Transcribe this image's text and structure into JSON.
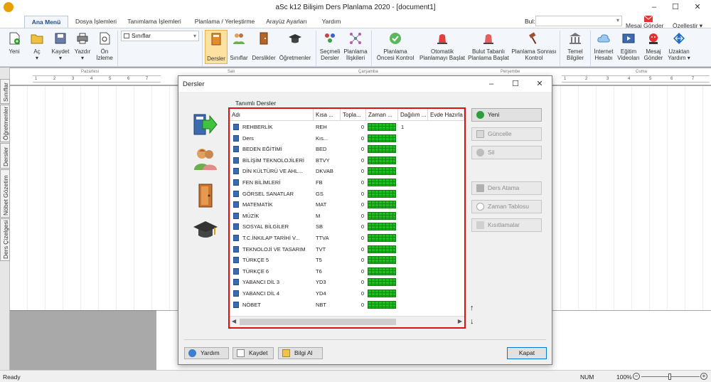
{
  "window": {
    "title": "aSc k12 Bilişim Ders Planlama 2020  - [document1]",
    "minimize": "–",
    "maximize": "☐",
    "close": "✕"
  },
  "ribbon_tabs": [
    "Ana Menü",
    "Dosya İşlemleri",
    "Tanımlama İşlemleri",
    "Planlama / Yerleştirme",
    "Arayüz Ayarları",
    "Yardım"
  ],
  "topright": {
    "search_label": "Bul:",
    "search_value": "",
    "mesaj": "Mesaj Gönder",
    "ozellestir": "Özelleştir ▾"
  },
  "ribbon": {
    "yeni": "Yeni",
    "ac": "Aç",
    "kaydet": "Kaydet",
    "yazdir": "Yazdır",
    "on_izleme_1": "Ön",
    "on_izleme_2": "İzleme",
    "class_selector": "Sınıflar",
    "dersler": "Dersler",
    "siniflar": "Sınıflar",
    "derslikler": "Derslikler",
    "ogretmenler": "Öğretmenler",
    "secmeli_1": "Seçmeli",
    "secmeli_2": "Dersler",
    "iliskileri_1": "Planlama",
    "iliskileri_2": "İlişkileri",
    "onces_1": "Planlama",
    "onces_2": "Öncesi Kontrol",
    "otomatik_1": "Otomatik",
    "otomatik_2": "Planlamayı Başlat",
    "bulut_1": "Bulut Tabanlı",
    "bulut_2": "Planlama Başlat",
    "sonrasi_1": "Planlama Sonrası",
    "sonrasi_2": "Kontrol",
    "temel_1": "Temel",
    "temel_2": "Bilgiler",
    "internet_1": "İnternet",
    "internet_2": "Hesabı",
    "egitim_1": "Eğitim",
    "egitim_2": "Videoları",
    "mesaj_1": "Mesaj",
    "mesaj_2": "Gönder",
    "uzaktan_1": "Uzaktan",
    "uzaktan_2": "Yardım ▾"
  },
  "left_tabs": [
    "Sınıflar",
    "Öğretmenler",
    "Dersler",
    "Nöbet Gözetim",
    "Ders Çizelgesi"
  ],
  "days": [
    "Pazartesi",
    "Salı",
    "Çarşamba",
    "Perşembe",
    "Cuma"
  ],
  "period_numbers": [
    "1",
    "2",
    "3",
    "4",
    "5",
    "6",
    "7"
  ],
  "status": {
    "ready": "Ready",
    "num": "NUM",
    "zoom": "100%"
  },
  "dialog": {
    "title": "Dersler",
    "section_label": "Tanımlı Dersler",
    "columns": [
      "Adı",
      "Kısa ...",
      "Topla...",
      "Zaman ...",
      "Dağılım ...",
      "Evde Hazırla"
    ],
    "rows": [
      {
        "name": "REHBERLİK",
        "short": "REH",
        "total": "0",
        "dist": "1"
      },
      {
        "name": "Ders",
        "short": "Kıs...",
        "total": "0",
        "dist": ""
      },
      {
        "name": "BEDEN EĞİTİMİ",
        "short": "BED",
        "total": "0",
        "dist": ""
      },
      {
        "name": "BİLİŞİM TEKNOLOJİLERİ",
        "short": "BTVY",
        "total": "0",
        "dist": ""
      },
      {
        "name": "DİN KÜLTÜRÜ VE AHL...",
        "short": "DKVAB",
        "total": "0",
        "dist": ""
      },
      {
        "name": "FEN BİLİMLERİ",
        "short": "FB",
        "total": "0",
        "dist": ""
      },
      {
        "name": "GÖRSEL SANATLAR",
        "short": "GS",
        "total": "0",
        "dist": ""
      },
      {
        "name": "MATEMATİK",
        "short": "MAT",
        "total": "0",
        "dist": ""
      },
      {
        "name": "MÜZİK",
        "short": "M",
        "total": "0",
        "dist": ""
      },
      {
        "name": "SOSYAL BİLGİLER",
        "short": "SB",
        "total": "0",
        "dist": ""
      },
      {
        "name": "T.C.İNKILAP TARİHİ V...",
        "short": "TTVA",
        "total": "0",
        "dist": ""
      },
      {
        "name": "TEKNOLOJİ VE TASARIM",
        "short": "TVT",
        "total": "0",
        "dist": ""
      },
      {
        "name": "TÜRKÇE 5",
        "short": "T5",
        "total": "0",
        "dist": ""
      },
      {
        "name": "TÜRKÇE 6",
        "short": "T6",
        "total": "0",
        "dist": ""
      },
      {
        "name": "YABANCI DİL 3",
        "short": "YD3",
        "total": "0",
        "dist": ""
      },
      {
        "name": "YABANCI DİL 4",
        "short": "YD4",
        "total": "0",
        "dist": ""
      },
      {
        "name": "NÖBET",
        "short": "NBT",
        "total": "0",
        "dist": ""
      }
    ],
    "buttons": {
      "yeni": "Yeni",
      "guncelle": "Güncelle",
      "sil": "Sil",
      "ders_atama": "Ders Atama",
      "zaman_tablosu": "Zaman Tablosu",
      "kisitlamalar": "Kısıtlamalar"
    },
    "bottom": {
      "yardim": "Yardım",
      "kaydet": "Kaydet",
      "bilgi_al": "Bilgi Al",
      "kapat": "Kapat"
    },
    "arrows": {
      "up": "↑",
      "down": "↓"
    }
  },
  "colors": {
    "accent": "#1e4e8c",
    "highlight_border": "#e01010",
    "timebar": "#1fbf1f"
  }
}
